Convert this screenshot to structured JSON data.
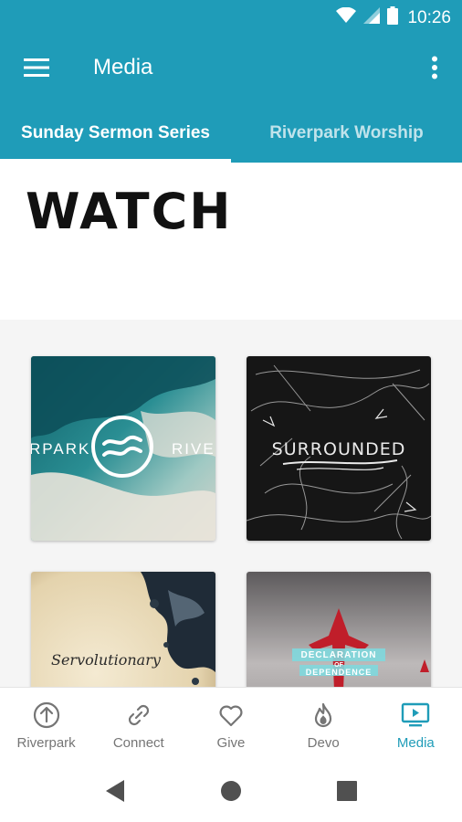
{
  "status_bar": {
    "time": "10:26",
    "icons": [
      "wifi-icon",
      "cell-signal-icon",
      "battery-icon"
    ]
  },
  "app_bar": {
    "title": "Media",
    "menu_icon": "hamburger-menu-icon",
    "overflow_icon": "more-vert-icon"
  },
  "tabs": [
    {
      "label": "Sunday Sermon Series",
      "active": true
    },
    {
      "label": "Riverpark Worship",
      "active": false
    }
  ],
  "content": {
    "heading": "WATCH",
    "series": [
      {
        "art_text_left": "RPARK",
        "art_text_right": "RIVE",
        "logo": "riverpark-waves-logo"
      },
      {
        "art_text": "SURROUNDED"
      },
      {
        "art_text": "Servolutionary"
      },
      {
        "art_text_top": "DECLARATION",
        "art_text_mid": "OF",
        "art_text_bottom": "DEPENDENCE"
      }
    ]
  },
  "bottom_nav": [
    {
      "label": "Riverpark",
      "icon": "arrow-up-circle-icon",
      "active": false
    },
    {
      "label": "Connect",
      "icon": "link-icon",
      "active": false
    },
    {
      "label": "Give",
      "icon": "heart-icon",
      "active": false
    },
    {
      "label": "Devo",
      "icon": "flame-icon",
      "active": false
    },
    {
      "label": "Media",
      "icon": "tv-play-icon",
      "active": true
    }
  ],
  "colors": {
    "brand": "#1f9cb8",
    "inactive": "#757575"
  }
}
